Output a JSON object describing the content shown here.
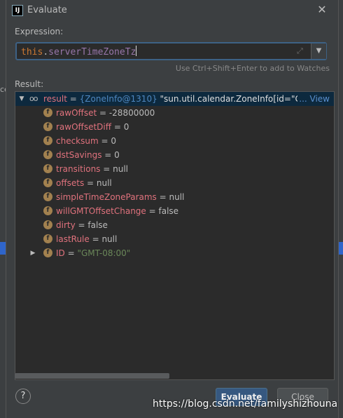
{
  "window": {
    "title": "Evaluate",
    "app_icon": "IJ"
  },
  "background": {
    "left_text": "ce"
  },
  "expression": {
    "label": "Expression:",
    "keyword": "this",
    "dot": ".",
    "field": "serverTimeZoneTz",
    "hint": "Use Ctrl+Shift+Enter to add to Watches"
  },
  "result": {
    "label": "Result:",
    "root": {
      "name": "result",
      "eq": " = ",
      "type": "{ZoneInfo@1310}",
      "summary": " \"sun.util.calendar.ZoneInfo[id=\"GMT",
      "view": "... View"
    },
    "fields": [
      {
        "name": "rawOffset",
        "value": "-28800000",
        "kind": "num"
      },
      {
        "name": "rawOffsetDiff",
        "value": "0",
        "kind": "num"
      },
      {
        "name": "checksum",
        "value": "0",
        "kind": "num"
      },
      {
        "name": "dstSavings",
        "value": "0",
        "kind": "num"
      },
      {
        "name": "transitions",
        "value": "null",
        "kind": "null"
      },
      {
        "name": "offsets",
        "value": "null",
        "kind": "null"
      },
      {
        "name": "simpleTimeZoneParams",
        "value": "null",
        "kind": "null"
      },
      {
        "name": "willGMTOffsetChange",
        "value": "false",
        "kind": "bool"
      },
      {
        "name": "dirty",
        "value": "false",
        "kind": "bool"
      },
      {
        "name": "lastRule",
        "value": "null",
        "kind": "null"
      },
      {
        "name": "ID",
        "value": "\"GMT-08:00\"",
        "kind": "str",
        "expandable": true
      }
    ],
    "field_icon": "f"
  },
  "buttons": {
    "help": "?",
    "evaluate": "Evaluate",
    "close": "Close"
  },
  "watermark": "https://blog.csdn.net/familyshizhouna",
  "colors": {
    "accent": "#365880",
    "selection": "#0d293e",
    "field_name": "#e0727d",
    "string": "#6a8759"
  }
}
